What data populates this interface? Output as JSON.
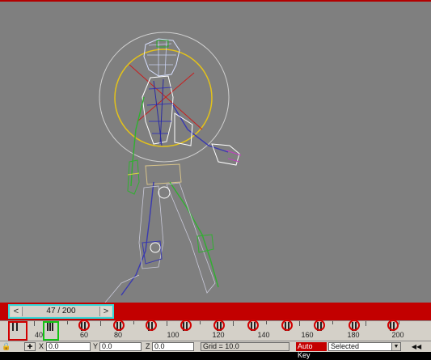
{
  "viewport": {
    "background": "#7f7f7f",
    "content": "wireframe walking character rig"
  },
  "time_slider": {
    "value_text": "47 / 200",
    "left_arrow": "<",
    "right_arrow": ">",
    "current_frame": 47,
    "total_frames": 200
  },
  "trackbar": {
    "tick_labels": [
      "40",
      "60",
      "80",
      "100",
      "120",
      "140",
      "160",
      "180",
      "200"
    ],
    "annotations": {
      "time_slider_highlight": "#35d6d6",
      "key_highlight": "#d10000",
      "current_frame_highlight": "#13c313"
    }
  },
  "statusbar": {
    "x_label": "X",
    "x_value": "0.0",
    "y_label": "Y",
    "y_value": "0.0",
    "z_label": "Z",
    "z_value": "0.0",
    "grid_text": "Grid = 10.0",
    "auto_key_label": "Auto Key",
    "selection_value": "Selected"
  },
  "icons": [
    "lock-icon",
    "selection-lock-icon",
    "previous-frame-icon"
  ]
}
